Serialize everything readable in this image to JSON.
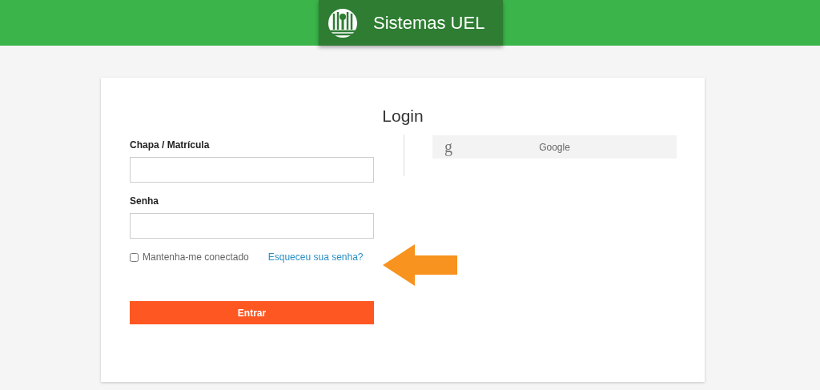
{
  "header": {
    "title": "Sistemas UEL"
  },
  "login": {
    "title": "Login",
    "fields": [
      {
        "label": "Chapa / Matrícula"
      },
      {
        "label": "Senha"
      }
    ],
    "remember": {
      "label": "Mantenha-me conectado",
      "checked": false
    },
    "forgot_link": "Esqueceu sua senha?",
    "submit": "Entrar",
    "google_button": {
      "icon": "g",
      "label": "Google"
    }
  }
}
